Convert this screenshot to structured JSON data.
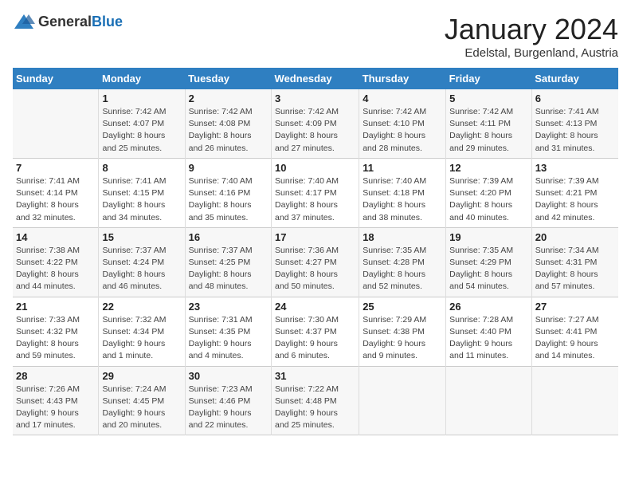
{
  "logo": {
    "general": "General",
    "blue": "Blue"
  },
  "header": {
    "month": "January 2024",
    "location": "Edelstal, Burgenland, Austria"
  },
  "days_of_week": [
    "Sunday",
    "Monday",
    "Tuesday",
    "Wednesday",
    "Thursday",
    "Friday",
    "Saturday"
  ],
  "weeks": [
    [
      {
        "day": "",
        "info": ""
      },
      {
        "day": "1",
        "info": "Sunrise: 7:42 AM\nSunset: 4:07 PM\nDaylight: 8 hours\nand 25 minutes."
      },
      {
        "day": "2",
        "info": "Sunrise: 7:42 AM\nSunset: 4:08 PM\nDaylight: 8 hours\nand 26 minutes."
      },
      {
        "day": "3",
        "info": "Sunrise: 7:42 AM\nSunset: 4:09 PM\nDaylight: 8 hours\nand 27 minutes."
      },
      {
        "day": "4",
        "info": "Sunrise: 7:42 AM\nSunset: 4:10 PM\nDaylight: 8 hours\nand 28 minutes."
      },
      {
        "day": "5",
        "info": "Sunrise: 7:42 AM\nSunset: 4:11 PM\nDaylight: 8 hours\nand 29 minutes."
      },
      {
        "day": "6",
        "info": "Sunrise: 7:41 AM\nSunset: 4:13 PM\nDaylight: 8 hours\nand 31 minutes."
      }
    ],
    [
      {
        "day": "7",
        "info": "Sunrise: 7:41 AM\nSunset: 4:14 PM\nDaylight: 8 hours\nand 32 minutes."
      },
      {
        "day": "8",
        "info": "Sunrise: 7:41 AM\nSunset: 4:15 PM\nDaylight: 8 hours\nand 34 minutes."
      },
      {
        "day": "9",
        "info": "Sunrise: 7:40 AM\nSunset: 4:16 PM\nDaylight: 8 hours\nand 35 minutes."
      },
      {
        "day": "10",
        "info": "Sunrise: 7:40 AM\nSunset: 4:17 PM\nDaylight: 8 hours\nand 37 minutes."
      },
      {
        "day": "11",
        "info": "Sunrise: 7:40 AM\nSunset: 4:18 PM\nDaylight: 8 hours\nand 38 minutes."
      },
      {
        "day": "12",
        "info": "Sunrise: 7:39 AM\nSunset: 4:20 PM\nDaylight: 8 hours\nand 40 minutes."
      },
      {
        "day": "13",
        "info": "Sunrise: 7:39 AM\nSunset: 4:21 PM\nDaylight: 8 hours\nand 42 minutes."
      }
    ],
    [
      {
        "day": "14",
        "info": "Sunrise: 7:38 AM\nSunset: 4:22 PM\nDaylight: 8 hours\nand 44 minutes."
      },
      {
        "day": "15",
        "info": "Sunrise: 7:37 AM\nSunset: 4:24 PM\nDaylight: 8 hours\nand 46 minutes."
      },
      {
        "day": "16",
        "info": "Sunrise: 7:37 AM\nSunset: 4:25 PM\nDaylight: 8 hours\nand 48 minutes."
      },
      {
        "day": "17",
        "info": "Sunrise: 7:36 AM\nSunset: 4:27 PM\nDaylight: 8 hours\nand 50 minutes."
      },
      {
        "day": "18",
        "info": "Sunrise: 7:35 AM\nSunset: 4:28 PM\nDaylight: 8 hours\nand 52 minutes."
      },
      {
        "day": "19",
        "info": "Sunrise: 7:35 AM\nSunset: 4:29 PM\nDaylight: 8 hours\nand 54 minutes."
      },
      {
        "day": "20",
        "info": "Sunrise: 7:34 AM\nSunset: 4:31 PM\nDaylight: 8 hours\nand 57 minutes."
      }
    ],
    [
      {
        "day": "21",
        "info": "Sunrise: 7:33 AM\nSunset: 4:32 PM\nDaylight: 8 hours\nand 59 minutes."
      },
      {
        "day": "22",
        "info": "Sunrise: 7:32 AM\nSunset: 4:34 PM\nDaylight: 9 hours\nand 1 minute."
      },
      {
        "day": "23",
        "info": "Sunrise: 7:31 AM\nSunset: 4:35 PM\nDaylight: 9 hours\nand 4 minutes."
      },
      {
        "day": "24",
        "info": "Sunrise: 7:30 AM\nSunset: 4:37 PM\nDaylight: 9 hours\nand 6 minutes."
      },
      {
        "day": "25",
        "info": "Sunrise: 7:29 AM\nSunset: 4:38 PM\nDaylight: 9 hours\nand 9 minutes."
      },
      {
        "day": "26",
        "info": "Sunrise: 7:28 AM\nSunset: 4:40 PM\nDaylight: 9 hours\nand 11 minutes."
      },
      {
        "day": "27",
        "info": "Sunrise: 7:27 AM\nSunset: 4:41 PM\nDaylight: 9 hours\nand 14 minutes."
      }
    ],
    [
      {
        "day": "28",
        "info": "Sunrise: 7:26 AM\nSunset: 4:43 PM\nDaylight: 9 hours\nand 17 minutes."
      },
      {
        "day": "29",
        "info": "Sunrise: 7:24 AM\nSunset: 4:45 PM\nDaylight: 9 hours\nand 20 minutes."
      },
      {
        "day": "30",
        "info": "Sunrise: 7:23 AM\nSunset: 4:46 PM\nDaylight: 9 hours\nand 22 minutes."
      },
      {
        "day": "31",
        "info": "Sunrise: 7:22 AM\nSunset: 4:48 PM\nDaylight: 9 hours\nand 25 minutes."
      },
      {
        "day": "",
        "info": ""
      },
      {
        "day": "",
        "info": ""
      },
      {
        "day": "",
        "info": ""
      }
    ]
  ]
}
